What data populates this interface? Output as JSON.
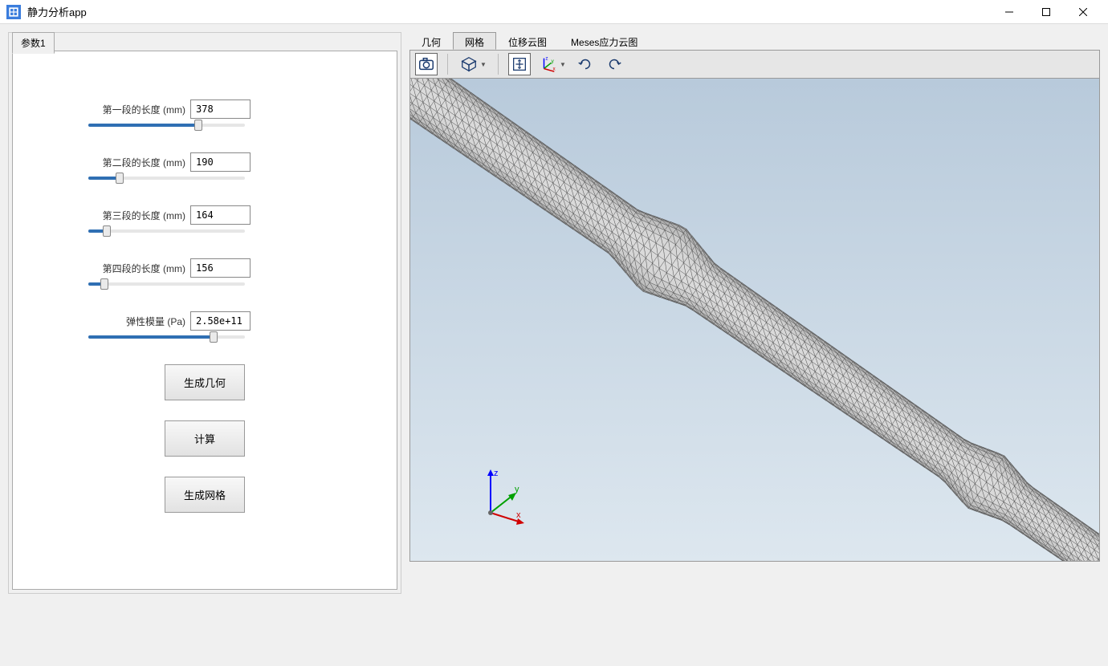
{
  "window": {
    "title": "静力分析app"
  },
  "left": {
    "tab_label": "参数1",
    "fields": [
      {
        "label": "第一段的长度 (mm)",
        "value": "378",
        "slider_pct": 70
      },
      {
        "label": "第二段的长度 (mm)",
        "value": "190",
        "slider_pct": 20
      },
      {
        "label": "第三段的长度 (mm)",
        "value": "164",
        "slider_pct": 12
      },
      {
        "label": "第四段的长度 (mm)",
        "value": "156",
        "slider_pct": 10
      },
      {
        "label": "弹性模量 (Pa)",
        "value": "2.58e+11",
        "slider_pct": 80
      }
    ],
    "buttons": {
      "gen_geometry": "生成几何",
      "compute": "计算",
      "gen_mesh": "生成网格"
    }
  },
  "view": {
    "tabs": [
      "几何",
      "网格",
      "位移云图",
      "Meses应力云图"
    ],
    "active_tab_index": 1,
    "axes": {
      "x": "x",
      "y": "y",
      "z": "z"
    }
  },
  "toolbar": {
    "icons": [
      "camera",
      "cube",
      "fit",
      "xyz",
      "rotate-ccw",
      "rotate-cw"
    ]
  }
}
